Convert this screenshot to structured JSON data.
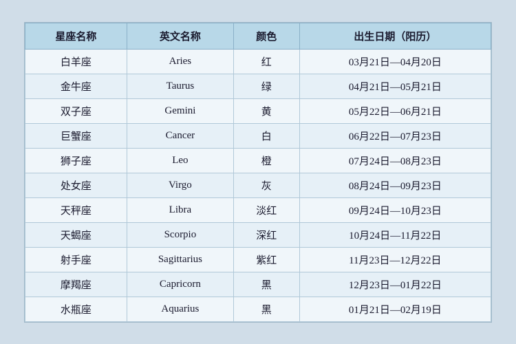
{
  "table": {
    "headers": [
      "星座名称",
      "英文名称",
      "颜色",
      "出生日期（阳历）"
    ],
    "rows": [
      [
        "白羊座",
        "Aries",
        "红",
        "03月21日—04月20日"
      ],
      [
        "金牛座",
        "Taurus",
        "绿",
        "04月21日—05月21日"
      ],
      [
        "双子座",
        "Gemini",
        "黄",
        "05月22日—06月21日"
      ],
      [
        "巨蟹座",
        "Cancer",
        "白",
        "06月22日—07月23日"
      ],
      [
        "狮子座",
        "Leo",
        "橙",
        "07月24日—08月23日"
      ],
      [
        "处女座",
        "Virgo",
        "灰",
        "08月24日—09月23日"
      ],
      [
        "天秤座",
        "Libra",
        "淡红",
        "09月24日—10月23日"
      ],
      [
        "天蝎座",
        "Scorpio",
        "深红",
        "10月24日—11月22日"
      ],
      [
        "射手座",
        "Sagittarius",
        "紫红",
        "11月23日—12月22日"
      ],
      [
        "摩羯座",
        "Capricorn",
        "黑",
        "12月23日—01月22日"
      ],
      [
        "水瓶座",
        "Aquarius",
        "黑",
        "01月21日—02月19日"
      ]
    ]
  }
}
